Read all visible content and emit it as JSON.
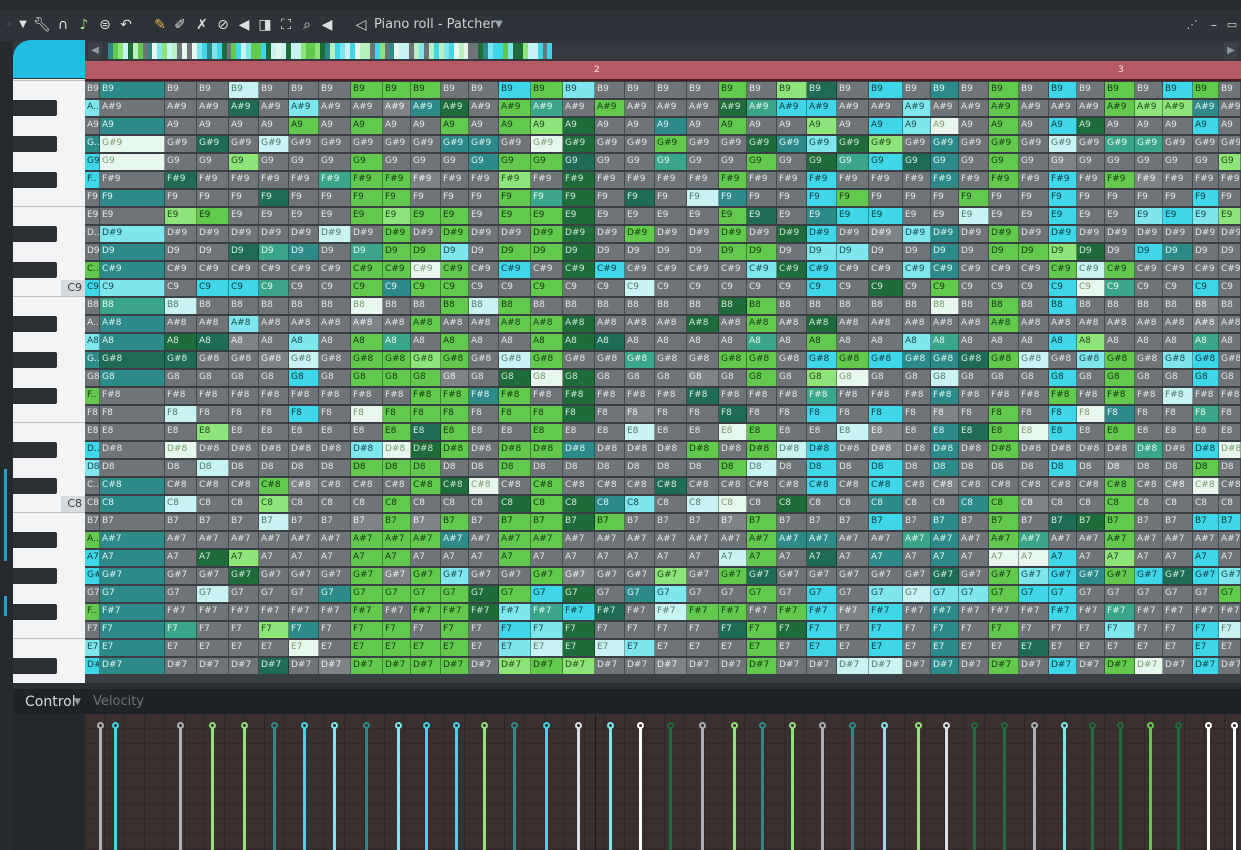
{
  "window": {
    "title": "Piano roll - Patcher"
  },
  "toolbar": {
    "icons": [
      "menu-arrow-icon",
      "wrench-icon",
      "magnet-icon",
      "note-icon",
      "snap-icon",
      "undo-icon",
      "pencil-icon",
      "paint-brush-icon",
      "delete-brush-icon",
      "mute-icon",
      "slice-icon",
      "select-icon",
      "zoom-icon",
      "playback-icon",
      "speaker-icon"
    ]
  },
  "timeline": {
    "bars": [
      "2",
      "3"
    ]
  },
  "keyboard": {
    "labels": [
      "C9",
      "C8"
    ]
  },
  "notes": {
    "octave9": [
      "B9",
      "A#9",
      "A9",
      "G#9",
      "G9",
      "F#9",
      "F9",
      "E9",
      "D#9",
      "D9",
      "C#9",
      "C9"
    ],
    "octave8": [
      "B8",
      "A#8",
      "A8",
      "G#8",
      "G8",
      "F#8",
      "F8",
      "E8",
      "D#8",
      "D8",
      "C#8",
      "C8"
    ],
    "octave7": [
      "B7",
      "A#7",
      "A7",
      "G#7",
      "G7",
      "F#7",
      "F7",
      "E7",
      "D#7"
    ],
    "truncated_prefix": [
      "B9",
      "A..",
      "A9",
      "G..",
      "G9",
      "F..",
      "F9",
      "E9",
      "D..",
      "D9",
      "C..",
      "C9",
      "B8",
      "A..",
      "A8",
      "G..",
      "G8",
      "F..",
      "F8",
      "E8",
      "D..",
      "D8",
      "C..",
      "C8",
      "B7",
      "A..",
      "A7",
      "G#7",
      "G7",
      "F..",
      "F7",
      "E7",
      "D#7"
    ]
  },
  "control": {
    "label": "Control",
    "parameter": "Velocity"
  },
  "colors": {
    "accent": "#21bde0",
    "timeline": "#b55a63",
    "note_gray": "#6e7478",
    "note_cyan": "#3fd6e8",
    "note_green": "#62c94e",
    "note_dark_green": "#1f6b3a"
  }
}
